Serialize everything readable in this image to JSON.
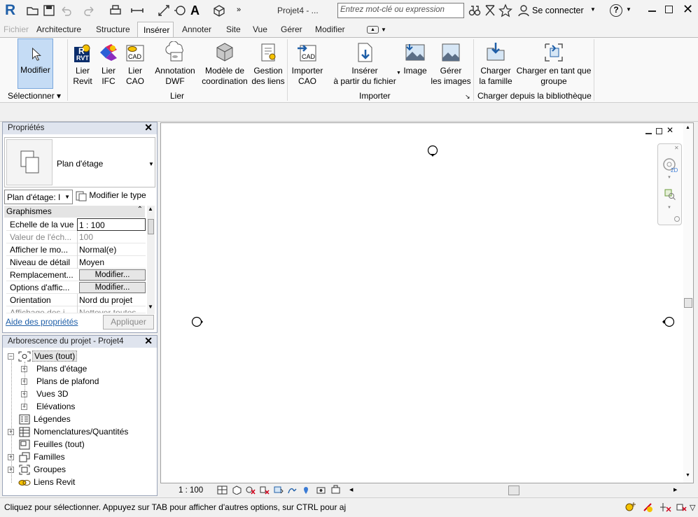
{
  "app": {
    "logo": "R",
    "title": "Projet4 - ...",
    "search_placeholder": "Entrez mot-clé ou expression",
    "signin": "Se connecter",
    "help": "?"
  },
  "menu": [
    "Fichier",
    "Architecture",
    "Structure",
    "Insérer",
    "Annoter",
    "Site",
    "Vue",
    "Gérer",
    "Modifier"
  ],
  "ribbon": {
    "modify": {
      "label": "Modifier"
    },
    "select_group": "Sélectionner",
    "link_buttons": [
      {
        "l1": "Lier",
        "l2": "Revit"
      },
      {
        "l1": "Lier",
        "l2": "IFC"
      },
      {
        "l1": "Lier",
        "l2": "CAO"
      },
      {
        "l1": "Annotation",
        "l2": "DWF"
      },
      {
        "l1": "Modèle de",
        "l2": "coordination"
      },
      {
        "l1": "Gestion",
        "l2": "des liens"
      }
    ],
    "link_group": "Lier",
    "import_buttons": [
      {
        "l1": "Importer",
        "l2": "CAO"
      },
      {
        "l1": "Insérer",
        "l2": "à partir du fichier"
      },
      {
        "l1": "Image",
        "l2": ""
      },
      {
        "l1": "Gérer",
        "l2": "les images"
      }
    ],
    "import_group": "Importer",
    "library_buttons": [
      {
        "l1": "Charger",
        "l2": "la famille"
      },
      {
        "l1": "Charger en tant que",
        "l2": "groupe"
      }
    ],
    "library_group": "Charger depuis la bibliothèque"
  },
  "properties": {
    "title": "Propriétés",
    "type_name": "Plan d'étage",
    "instance_select": "Plan d'étage: I",
    "edit_type": "Modifier le type",
    "section": "Graphismes",
    "rows": [
      {
        "k": "Echelle de la vue",
        "v": "1 : 100"
      },
      {
        "k": "Valeur de l'éch...",
        "v": "100"
      },
      {
        "k": "Afficher le mo...",
        "v": "Normal(e)"
      },
      {
        "k": "Niveau de détail",
        "v": "Moyen"
      },
      {
        "k": "Remplacement...",
        "v": "Modifier..."
      },
      {
        "k": "Options d'affic...",
        "v": "Modifier..."
      },
      {
        "k": "Orientation",
        "v": "Nord du projet"
      },
      {
        "k": "Affichage des j...",
        "v": "Nettoyer toutes..."
      }
    ],
    "help_link": "Aide des propriétés",
    "apply": "Appliquer"
  },
  "browser": {
    "title": "Arborescence du projet - Projet4",
    "items": [
      {
        "label": "Vues (tout)"
      },
      {
        "label": "Plans d'étage"
      },
      {
        "label": "Plans de plafond"
      },
      {
        "label": "Vues 3D"
      },
      {
        "label": "Elévations"
      },
      {
        "label": "Légendes"
      },
      {
        "label": "Nomenclatures/Quantités"
      },
      {
        "label": "Feuilles (tout)"
      },
      {
        "label": "Familles"
      },
      {
        "label": "Groupes"
      },
      {
        "label": "Liens Revit"
      }
    ]
  },
  "view": {
    "scale": "1 : 100"
  },
  "status": "Cliquez pour sélectionner. Appuyez sur TAB pour afficher d'autres options, sur CTRL pour aj",
  "colors": {
    "accent": "#1f5fa8",
    "panel_header": "#dfe4ee",
    "selected": "#c5dcf5"
  }
}
